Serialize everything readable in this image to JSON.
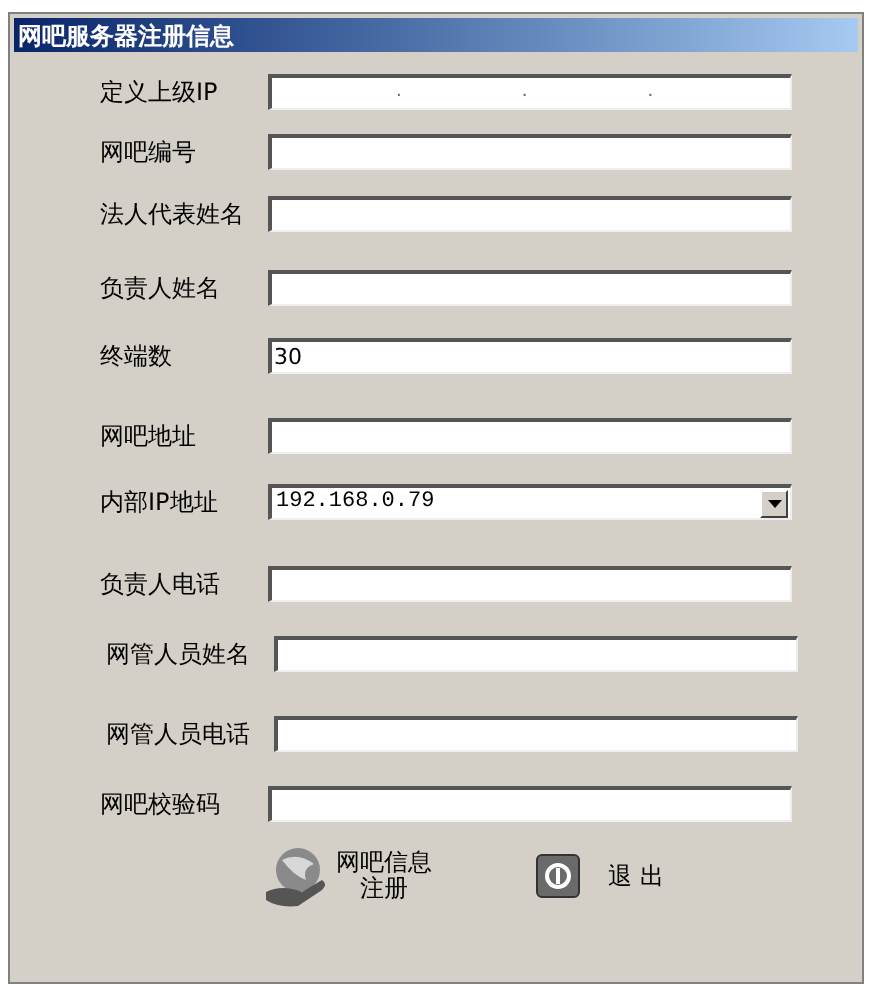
{
  "window": {
    "title": "网吧服务器注册信息"
  },
  "fields": [
    {
      "label": "定义上级IP",
      "kind": "ip",
      "separators": [
        ".",
        ".",
        "."
      ]
    },
    {
      "label": "网吧编号",
      "kind": "text"
    },
    {
      "label": "法人代表姓名",
      "kind": "text"
    },
    {
      "label": "负责人姓名",
      "kind": "text"
    },
    {
      "label": "终端数",
      "kind": "text",
      "value": "30"
    },
    {
      "label": "网吧地址",
      "kind": "text"
    },
    {
      "label": "内部IP地址",
      "kind": "combo",
      "value": "192.168.0.79"
    },
    {
      "label": "负责人电话",
      "kind": "text"
    },
    {
      "label": "网管人员姓名",
      "kind": "text"
    },
    {
      "label": "网管人员电话",
      "kind": "text"
    },
    {
      "label": "网吧校验码",
      "kind": "text"
    }
  ],
  "buttons": [
    {
      "kind": "register",
      "label_lines": [
        "网吧信息",
        "注册"
      ]
    },
    {
      "kind": "exit",
      "label": "退 出"
    }
  ]
}
